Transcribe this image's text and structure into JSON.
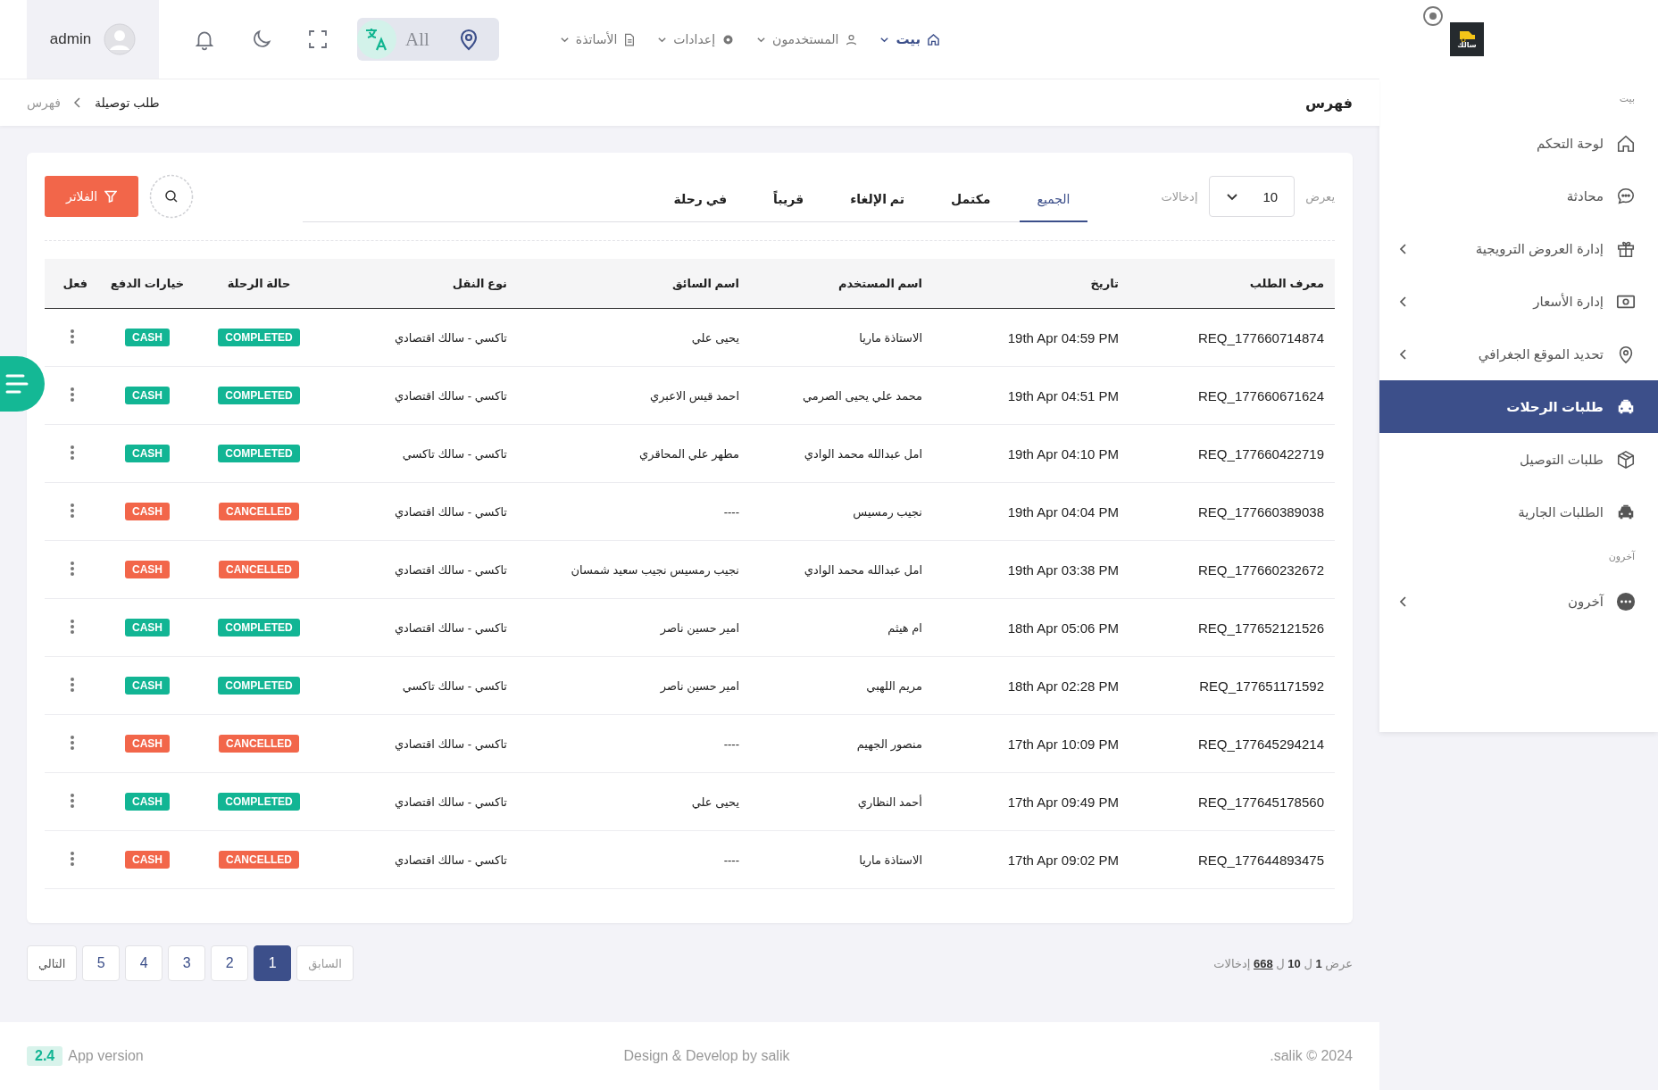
{
  "header": {
    "user": "admin",
    "language": "All",
    "nav": [
      {
        "label": "بيت",
        "selected": true
      },
      {
        "label": "المستخدمون",
        "selected": false
      },
      {
        "label": "إعدادات",
        "selected": false
      },
      {
        "label": "الأساتذة",
        "selected": false
      }
    ]
  },
  "breadcrumb": {
    "title": "فهرس",
    "trail": [
      "طلب توصيلة",
      "فهرس"
    ]
  },
  "toolbar": {
    "show_label": "يعرض",
    "page_size": "10",
    "entries_label": "إدخالات",
    "filter_button": "الفلاتر"
  },
  "tabs": [
    {
      "label": "الجميع",
      "selected": true
    },
    {
      "label": "مكتمل",
      "selected": false
    },
    {
      "label": "تم الإلغاء",
      "selected": false
    },
    {
      "label": "قريباً",
      "selected": false
    },
    {
      "label": "في رحلة",
      "selected": false
    }
  ],
  "table": {
    "columns": [
      "معرف الطلب",
      "تاريخ",
      "اسم المستخدم",
      "اسم السائق",
      "نوع النقل",
      "حالة الرحلة",
      "خيارات الدفع",
      "فعل"
    ],
    "rows": [
      {
        "id": "REQ_177660714874",
        "date": "19th Apr 04:59 PM",
        "user": "الاستاذة ماريا",
        "driver": "يحيى علي",
        "transport": "تاكسي - سالك اقتصادي",
        "status": "COMPLETED",
        "payment": "CASH",
        "kind": "completed"
      },
      {
        "id": "REQ_177660671624",
        "date": "19th Apr 04:51 PM",
        "user": "محمد علي يحيى الصرمي",
        "driver": "احمد قيس الاعبري",
        "transport": "تاكسي - سالك اقتصادي",
        "status": "COMPLETED",
        "payment": "CASH",
        "kind": "completed"
      },
      {
        "id": "REQ_177660422719",
        "date": "19th Apr 04:10 PM",
        "user": "امل عبدالله محمد الوادي",
        "driver": "مطهر علي المحاقري",
        "transport": "تاكسي - سالك تاكسي",
        "status": "COMPLETED",
        "payment": "CASH",
        "kind": "completed"
      },
      {
        "id": "REQ_177660389038",
        "date": "19th Apr 04:04 PM",
        "user": "نجيب رمسيس",
        "driver": "----",
        "transport": "تاكسي - سالك اقتصادي",
        "status": "CANCELLED",
        "payment": "CASH",
        "kind": "cancelled"
      },
      {
        "id": "REQ_177660232672",
        "date": "19th Apr 03:38 PM",
        "user": "امل عبدالله محمد الوادي",
        "driver": "نجيب رمسيس نجيب سعيد شمسان",
        "transport": "تاكسي - سالك اقتصادي",
        "status": "CANCELLED",
        "payment": "CASH",
        "kind": "cancelled"
      },
      {
        "id": "REQ_177652121526",
        "date": "18th Apr 05:06 PM",
        "user": "ام هيثم",
        "driver": "امير حسين ناصر",
        "transport": "تاكسي - سالك اقتصادي",
        "status": "COMPLETED",
        "payment": "CASH",
        "kind": "completed"
      },
      {
        "id": "REQ_177651171592",
        "date": "18th Apr 02:28 PM",
        "user": "مريم اللهبي",
        "driver": "امير حسين ناصر",
        "transport": "تاكسي - سالك تاكسي",
        "status": "COMPLETED",
        "payment": "CASH",
        "kind": "completed"
      },
      {
        "id": "REQ_177645294214",
        "date": "17th Apr 10:09 PM",
        "user": "منصور الجهيم",
        "driver": "----",
        "transport": "تاكسي - سالك اقتصادي",
        "status": "CANCELLED",
        "payment": "CASH",
        "kind": "cancelled"
      },
      {
        "id": "REQ_177645178560",
        "date": "17th Apr 09:49 PM",
        "user": "أحمد النظاري",
        "driver": "يحيى علي",
        "transport": "تاكسي - سالك اقتصادي",
        "status": "COMPLETED",
        "payment": "CASH",
        "kind": "completed"
      },
      {
        "id": "REQ_177644893475",
        "date": "17th Apr 09:02 PM",
        "user": "الاستاذة ماريا",
        "driver": "----",
        "transport": "تاكسي - سالك اقتصادي",
        "status": "CANCELLED",
        "payment": "CASH",
        "kind": "cancelled"
      }
    ]
  },
  "pagination": {
    "summary": "عرض **1** ل **10** ل **668** إدخالات",
    "previous": "السابق",
    "next": "التالي",
    "pages": [
      {
        "label": "1",
        "selected": true
      },
      {
        "label": "2",
        "selected": false
      },
      {
        "label": "3",
        "selected": false
      },
      {
        "label": "4",
        "selected": false
      },
      {
        "label": "5",
        "selected": false
      }
    ]
  },
  "footer": {
    "version": "2.4",
    "version_label": "App version",
    "credit": "Design & Develop by salik",
    "copyright": ".salik © 2024"
  },
  "sidebar": {
    "logo_text": "سالك",
    "sections": [
      {
        "label": "بيت",
        "items": [
          {
            "label": "لوحة التحكم",
            "selected": false,
            "expandable": false
          },
          {
            "label": "محادثة",
            "selected": false,
            "expandable": false
          },
          {
            "label": "إدارة العروض الترويجية",
            "selected": false,
            "expandable": true
          },
          {
            "label": "إدارة الأسعار",
            "selected": false,
            "expandable": true
          },
          {
            "label": "تحديد الموقع الجغرافي",
            "selected": false,
            "expandable": true
          },
          {
            "label": "طلبات الرحلات",
            "selected": true,
            "expandable": false
          },
          {
            "label": "طلبات التوصيل",
            "selected": false,
            "expandable": false
          },
          {
            "label": "الطلبات الجارية",
            "selected": false,
            "expandable": false
          }
        ]
      },
      {
        "label": "آخرون",
        "items": [
          {
            "label": "آخرون",
            "selected": false,
            "expandable": true
          }
        ]
      }
    ]
  }
}
